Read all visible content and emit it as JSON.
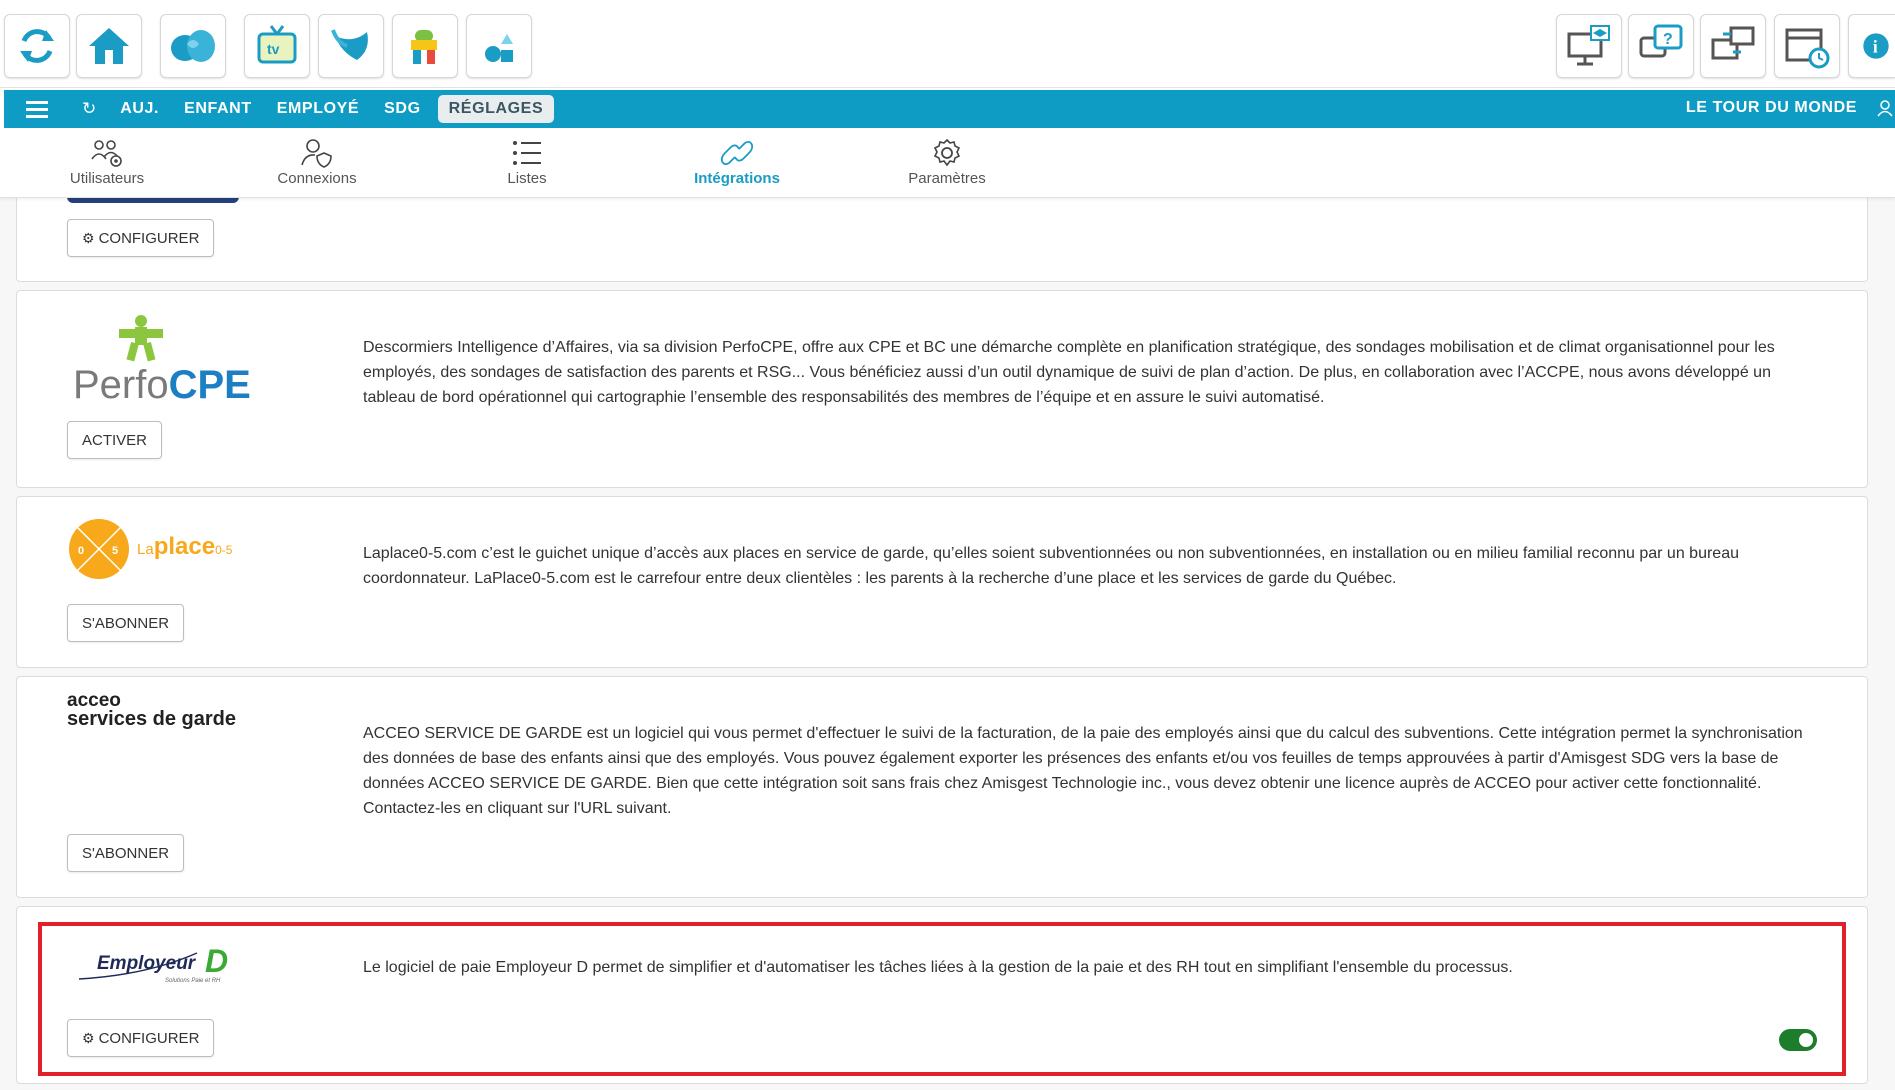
{
  "topbar": {
    "apps": [
      {
        "icon": "refresh-icon"
      },
      {
        "icon": "home-icon"
      },
      {
        "icon": "heart-cloud-icon"
      },
      {
        "icon": "tv-icon",
        "label": "tv"
      },
      {
        "icon": "leaf-icon"
      },
      {
        "icon": "character-icon"
      },
      {
        "icon": "shapes-icon"
      }
    ],
    "right_tools": [
      {
        "icon": "monitor-graduation-icon"
      },
      {
        "icon": "chat-question-icon"
      },
      {
        "icon": "remote-desktop-icon"
      },
      {
        "icon": "calendar-clock-icon"
      },
      {
        "icon": "info-icon",
        "label": "i"
      }
    ]
  },
  "navbar": {
    "menu_icon": "hamburger-icon",
    "refresh_icon": "refresh-icon",
    "items": [
      "AUJ.",
      "ENFANT",
      "EMPLOYÉ",
      "SDG",
      "RÉGLAGES"
    ],
    "active": "RÉGLAGES",
    "org_name": "LE TOUR DU MONDE",
    "user_icon": "user-icon"
  },
  "subnav": {
    "tabs": [
      {
        "label": "Utilisateurs",
        "icon": "users-gear-icon"
      },
      {
        "label": "Connexions",
        "icon": "user-shield-icon"
      },
      {
        "label": "Listes",
        "icon": "list-icon"
      },
      {
        "label": "Intégrations",
        "icon": "link-icon"
      },
      {
        "label": "Paramètres",
        "icon": "gear-icon"
      }
    ],
    "active": "Intégrations"
  },
  "integrations": [
    {
      "button": "CONFIGURER"
    },
    {
      "logo": "PerfoCPE",
      "logo_parts": [
        "Perfo",
        "CPE"
      ],
      "button": "ACTIVER",
      "description": "Descormiers Intelligence d’Affaires, via sa division PerfoCPE, offre aux CPE et BC une démarche complète en planification stratégique, des sondages mobilisation et de climat organisationnel pour les employés, des sondages de satisfaction des parents et RSG... Vous bénéficiez aussi d’un outil dynamique de suivi de plan d’action. De plus, en collaboration avec l’ACCPE, nous avons développé un tableau de bord opérationnel qui cartographie l’ensemble des responsabilités des membres de l’équipe et en assure le suivi automatisé."
    },
    {
      "logo_parts": [
        "La",
        "place",
        "0-5"
      ],
      "logo_digits": [
        "0",
        "5"
      ],
      "button": "S'ABONNER",
      "description": "Laplace0-5.com c’est le guichet unique d’accès aux places en service de garde, qu’elles soient subventionnées ou non subventionnées, en installation ou en milieu familial reconnu par un bureau coordonnateur. LaPlace0-5.com est le carrefour entre deux clientèles : les parents à la recherche d’une place et les services de garde du Québec."
    },
    {
      "logo_lines": [
        "acceo",
        "services de garde"
      ],
      "button": "S'ABONNER",
      "description": "ACCEO SERVICE DE GARDE est un logiciel qui vous permet d'effectuer le suivi de la facturation, de la paie des employés ainsi que du calcul des subventions. Cette intégration permet la synchronisation des données de base des enfants ainsi que des employés. Vous pouvez également exporter les présences des enfants et/ou vos feuilles de temps approuvées à partir d'Amisgest SDG vers la base de données ACCEO SERVICE DE GARDE. Bien que cette intégration soit sans frais chez Amisgest Technologie inc., vous devez obtenir une licence auprès de ACCEO pour activer cette fonctionnalité. Contactez-les en cliquant sur l'URL suivant."
    },
    {
      "logo": "Employeur D",
      "logo_parts": [
        "Employeur",
        "D"
      ],
      "logo_tagline": "Solutions Paie et RH",
      "button": "CONFIGURER",
      "enabled": true,
      "description": "Le logiciel de paie Employeur D permet de simplifier et d'automatiser les tâches liées à la gestion de la paie et des RH tout en simplifiant l'ensemble du processus."
    }
  ],
  "colors": {
    "navbar": "#0e9cc4",
    "active_tab": "#1a9cc4",
    "toggle_on": "#1e7d2c",
    "highlight": "#e0202a"
  }
}
